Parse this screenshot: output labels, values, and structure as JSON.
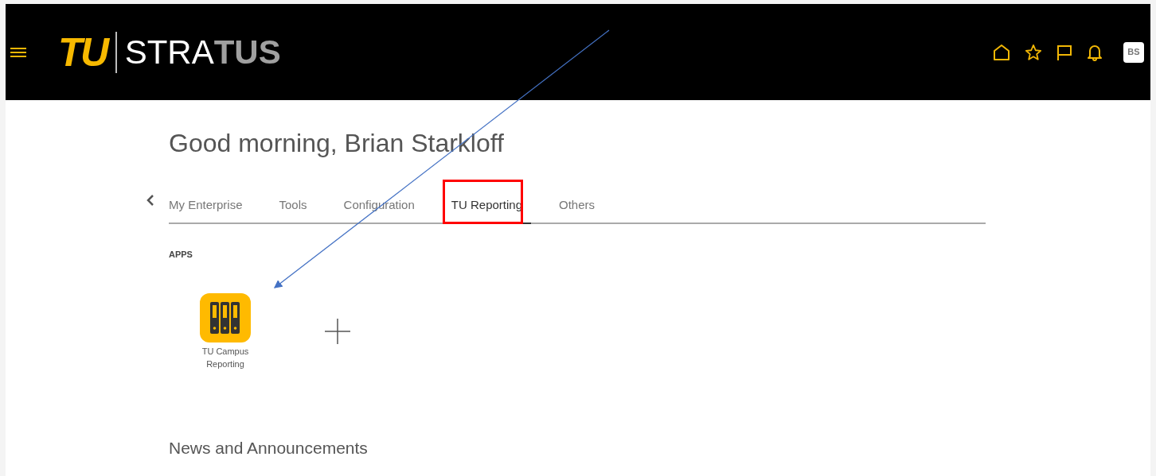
{
  "header": {
    "logo": {
      "mark": "TU",
      "word_light": "STRA",
      "word_dark": "TUS"
    },
    "avatar": "BS"
  },
  "greeting": "Good morning, Brian Starkloff",
  "tabs": [
    {
      "label": "My Enterprise",
      "selected": false,
      "highlighted": false
    },
    {
      "label": "Tools",
      "selected": false,
      "highlighted": false
    },
    {
      "label": "Configuration",
      "selected": false,
      "highlighted": false
    },
    {
      "label": "TU Reporting",
      "selected": true,
      "highlighted": true
    },
    {
      "label": "Others",
      "selected": false,
      "highlighted": false
    }
  ],
  "apps_heading": "APPS",
  "apps": [
    {
      "kind": "app",
      "label": "TU Campus Reporting"
    },
    {
      "kind": "add"
    }
  ],
  "news_heading": "News and Announcements"
}
